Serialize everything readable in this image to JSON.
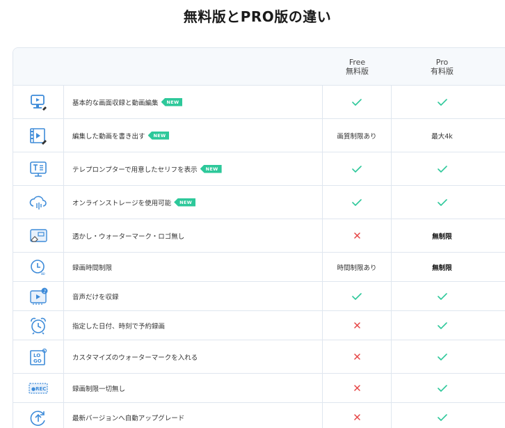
{
  "title": "無料版とPRO版の違い",
  "columns": {
    "free_en": "Free",
    "free_jp": "無料版",
    "pro_en": "Pro",
    "pro_jp": "有料版"
  },
  "badge_text": "NEW",
  "colors": {
    "check": "#2dc89a",
    "cross": "#e64545",
    "icon": "#3d8bd9",
    "border": "#dfe6ef"
  },
  "rows": [
    {
      "icon": "screen-record-edit-icon",
      "feature": "基本的な画面収録と動画編集",
      "new": true,
      "free": {
        "type": "check"
      },
      "pro": {
        "type": "check"
      }
    },
    {
      "icon": "video-export-icon",
      "feature": "編集した動画を書き出す",
      "new": true,
      "free": {
        "type": "text",
        "text": "画質制限あり"
      },
      "pro": {
        "type": "text",
        "text": "最大4k"
      }
    },
    {
      "icon": "teleprompter-icon",
      "feature": "テレプロンプターで用意したセリフを表示",
      "new": true,
      "free": {
        "type": "check"
      },
      "pro": {
        "type": "check"
      }
    },
    {
      "icon": "cloud-storage-icon",
      "feature": "オンラインストレージを使用可能",
      "new": true,
      "free": {
        "type": "check"
      },
      "pro": {
        "type": "check"
      }
    },
    {
      "icon": "watermark-erase-icon",
      "feature": "透かし・ウォーターマーク・ロゴ無し",
      "new": false,
      "free": {
        "type": "cross"
      },
      "pro": {
        "type": "bold",
        "text": "無制限"
      }
    },
    {
      "icon": "unlimited-time-icon",
      "feature": "録画時間制限",
      "new": false,
      "free": {
        "type": "text",
        "text": "時間制限あり"
      },
      "pro": {
        "type": "bold",
        "text": "無制限"
      }
    },
    {
      "icon": "audio-record-icon",
      "feature": "音声だけを収録",
      "new": false,
      "free": {
        "type": "check"
      },
      "pro": {
        "type": "check"
      }
    },
    {
      "icon": "alarm-clock-icon",
      "feature": "指定した日付、時刻で予約録画",
      "new": false,
      "free": {
        "type": "cross"
      },
      "pro": {
        "type": "check"
      }
    },
    {
      "icon": "logo-watermark-icon",
      "feature": "カスタマイズのウォーターマークを入れる",
      "new": false,
      "free": {
        "type": "cross"
      },
      "pro": {
        "type": "check"
      }
    },
    {
      "icon": "rec-icon",
      "feature": "録画制限一切無し",
      "new": false,
      "free": {
        "type": "cross"
      },
      "pro": {
        "type": "check"
      }
    },
    {
      "icon": "auto-upgrade-icon",
      "feature": "最新バージョンへ自動アップグレード",
      "new": false,
      "free": {
        "type": "cross"
      },
      "pro": {
        "type": "check"
      }
    }
  ],
  "icon_labels": {
    "logo_top": "LO",
    "logo_bottom": "GO",
    "rec": "●REC"
  }
}
